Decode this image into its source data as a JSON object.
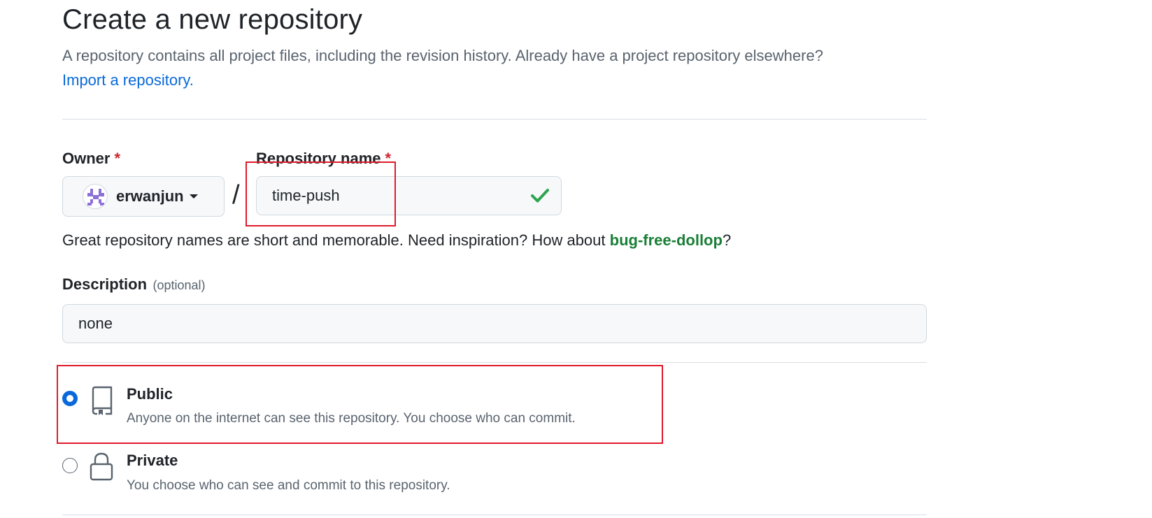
{
  "header": {
    "title": "Create a new repository",
    "subtitle": "A repository contains all project files, including the revision history. Already have a project repository elsewhere?",
    "import_link": "Import a repository."
  },
  "owner": {
    "label": "Owner",
    "required_mark": "*",
    "value": "erwanjun",
    "avatar_icon": "identicon-avatar",
    "caret_icon": "caret-down-icon"
  },
  "separator": "/",
  "repo_name": {
    "label": "Repository name",
    "required_mark": "*",
    "value": "time-push",
    "status_icon": "check-icon",
    "status_color": "#2da44e"
  },
  "name_hint": {
    "text": "Great repository names are short and memorable. Need inspiration? How about ",
    "suggestion": "bug-free-dollop",
    "suffix": "?"
  },
  "description": {
    "label": "Description",
    "optional": "(optional)",
    "value": "none"
  },
  "visibility": {
    "options": [
      {
        "title": "Public",
        "description": "Anyone on the internet can see this repository. You choose who can commit.",
        "icon": "repo-icon",
        "selected": true
      },
      {
        "title": "Private",
        "description": "You choose who can see and commit to this repository.",
        "icon": "lock-icon",
        "selected": false
      }
    ]
  },
  "colors": {
    "link": "#0969da",
    "suggestion": "#1a7f37",
    "required": "#d1242f",
    "annotation": "#e01a2a"
  }
}
